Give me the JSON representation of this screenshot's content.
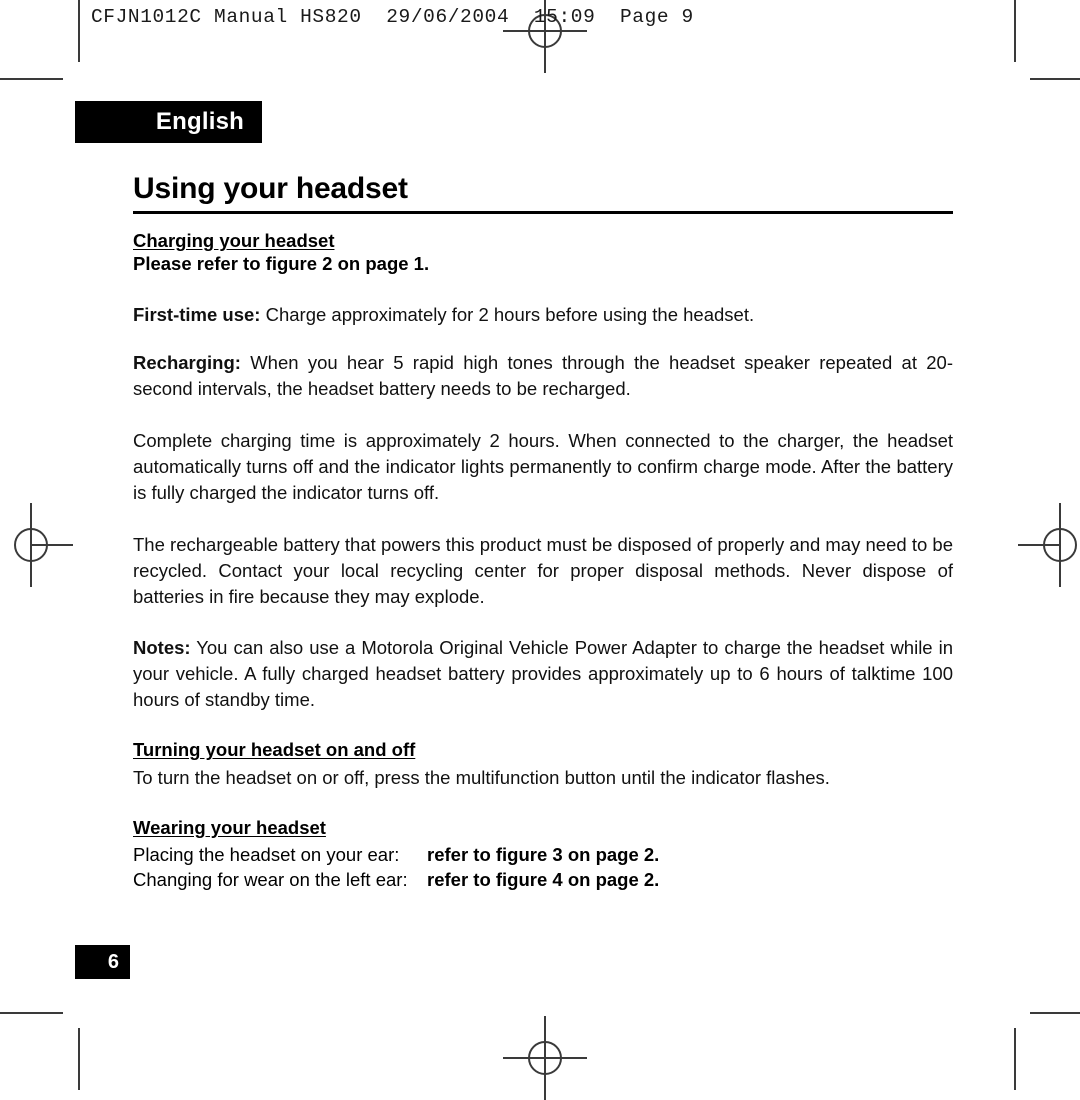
{
  "press_marks": {
    "header_line": "CFJN1012C Manual HS820  29/06/2004  15:09  Page 9"
  },
  "banner": {
    "language": "English"
  },
  "title": "Using your headset",
  "sections": {
    "charging": {
      "heading": "Charging your headset",
      "refer_line": "Please refer to figure 2 on page 1.",
      "first_time_label": "First-time use:",
      "first_time_text": " Charge approximately for 2 hours before using the headset.",
      "recharging_label": "Recharging:",
      "recharging_text": " When you hear 5 rapid high tones through the headset speaker repeated at 20-second intervals, the headset battery needs to be recharged.",
      "complete_charge_para": "Complete charging time is approximately 2 hours. When connected to the charger, the headset automatically turns off and the indicator lights permanently to confirm charge mode. After the battery is fully charged the indicator turns off.",
      "battery_disposal_para": "The rechargeable battery that powers this product must be disposed of properly and may need to be recycled. Contact your local recycling center for proper disposal methods. Never dispose of batteries in fire because they may explode.",
      "notes_label": "Notes:",
      "notes_text": " You can also use a Motorola Original Vehicle Power Adapter to charge the headset while in your vehicle. A fully charged headset battery provides approximately up to 6 hours of talktime 100 hours of standby time."
    },
    "turning_on_off": {
      "heading": "Turning your headset on and off",
      "text": "To turn the headset on or off, press the multifunction button until the indicator flashes."
    },
    "wearing": {
      "heading": "Wearing your headset",
      "row1_label": "Placing the headset on your ear:",
      "row1_ref": "refer to figure 3 on page 2.",
      "row2_label": "Changing for wear on the left ear:",
      "row2_ref": "refer to figure 4 on page 2."
    }
  },
  "footer": {
    "page_number": "6"
  },
  "colors": {
    "ink": "#000000",
    "banner_bg": "#000000",
    "banner_text": "#ffffff",
    "mark": "#3a3a3a"
  }
}
